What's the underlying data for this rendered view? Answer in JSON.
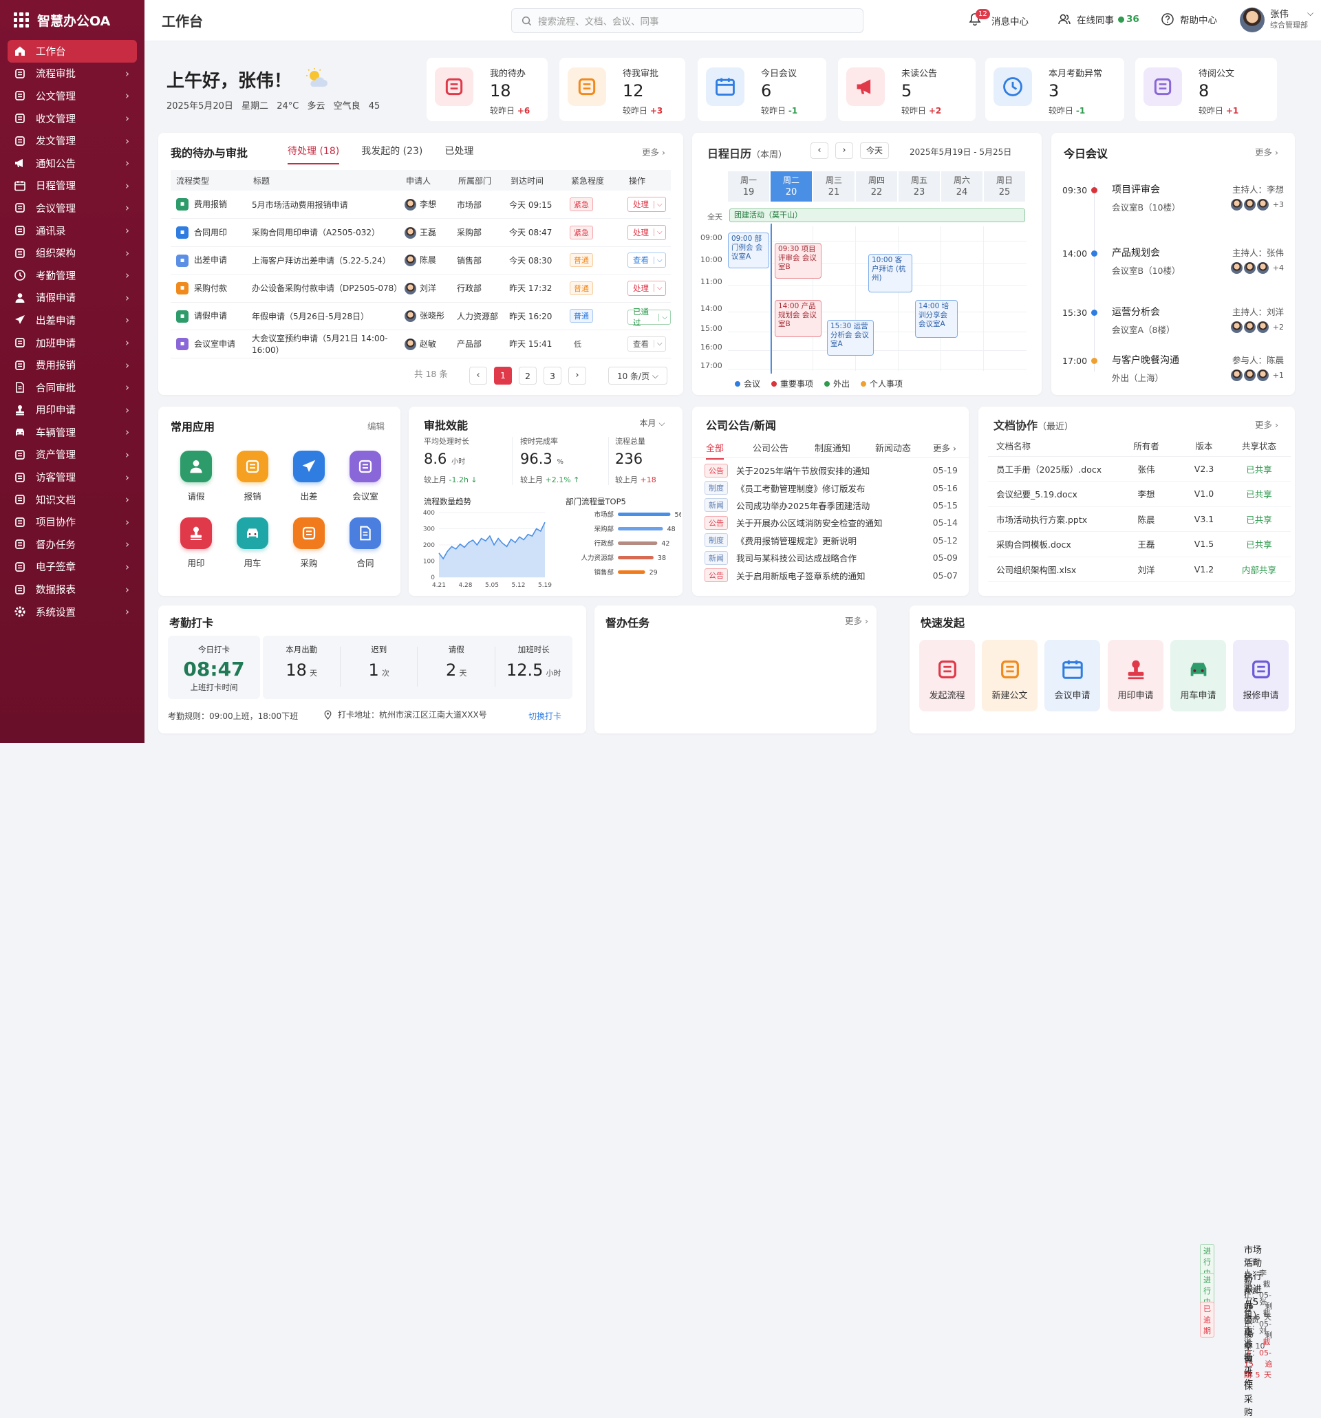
{
  "app": {
    "name": "智慧办公OA"
  },
  "sidebar": {
    "items": [
      {
        "label": "工作台",
        "icon": "home-icon",
        "active": true
      },
      {
        "label": "流程审批",
        "icon": "layers-icon"
      },
      {
        "label": "公文管理",
        "icon": "folder-icon"
      },
      {
        "label": "收文管理",
        "icon": "mail-icon"
      },
      {
        "label": "发文管理",
        "icon": "send-icon"
      },
      {
        "label": "通知公告",
        "icon": "megaphone-icon"
      },
      {
        "label": "日程管理",
        "icon": "calendar-icon"
      },
      {
        "label": "会议管理",
        "icon": "meeting-icon"
      },
      {
        "label": "通讯录",
        "icon": "contacts-icon"
      },
      {
        "label": "组织架构",
        "icon": "org-icon"
      },
      {
        "label": "考勤管理",
        "icon": "clock-icon"
      },
      {
        "label": "请假申请",
        "icon": "user-leave-icon"
      },
      {
        "label": "出差申请",
        "icon": "plane-icon"
      },
      {
        "label": "加班申请",
        "icon": "overtime-icon"
      },
      {
        "label": "费用报销",
        "icon": "wallet-icon"
      },
      {
        "label": "合同审批",
        "icon": "contract-icon"
      },
      {
        "label": "用印申请",
        "icon": "stamp-icon"
      },
      {
        "label": "车辆管理",
        "icon": "car-icon"
      },
      {
        "label": "资产管理",
        "icon": "box-icon"
      },
      {
        "label": "访客管理",
        "icon": "visitor-icon"
      },
      {
        "label": "知识文档",
        "icon": "book-icon"
      },
      {
        "label": "项目协作",
        "icon": "project-icon"
      },
      {
        "label": "督办任务",
        "icon": "task-icon"
      },
      {
        "label": "电子签章",
        "icon": "sign-icon"
      },
      {
        "label": "数据报表",
        "icon": "chart-icon"
      },
      {
        "label": "系统设置",
        "icon": "gear-icon"
      }
    ]
  },
  "header": {
    "title": "工作台",
    "search_placeholder": "搜索流程、文档、会议、同事",
    "notify_count": "12",
    "notify_label": "消息中心",
    "online_label": "在线同事",
    "online_count": "36",
    "help_label": "帮助中心",
    "user_name": "张伟",
    "user_dept": "综合管理部"
  },
  "greeting": {
    "text": "上午好，张伟！",
    "date": "2025年5月20日",
    "weekday": "星期二",
    "weather": "24°C 多云",
    "air": "空气良 45"
  },
  "stats": [
    {
      "label": "我的待办",
      "value": "18",
      "cmp": "较昨日",
      "delta": "+6",
      "dir": "up",
      "icon": "clipboard-icon",
      "color": "#e0394a",
      "bg": "#fde8ea"
    },
    {
      "label": "待我审批",
      "value": "12",
      "cmp": "较昨日",
      "delta": "+3",
      "dir": "up",
      "icon": "approver-icon",
      "color": "#f08a1c",
      "bg": "#fff1e2"
    },
    {
      "label": "今日会议",
      "value": "6",
      "cmp": "较昨日",
      "delta": "-1",
      "dir": "down",
      "icon": "calendar-icon",
      "color": "#2f7de1",
      "bg": "#e6f0fc"
    },
    {
      "label": "未读公告",
      "value": "5",
      "cmp": "较昨日",
      "delta": "+2",
      "dir": "up",
      "icon": "megaphone-icon",
      "color": "#e0394a",
      "bg": "#fde8ea"
    },
    {
      "label": "本月考勤异常",
      "value": "3",
      "cmp": "较昨日",
      "delta": "-1",
      "dir": "down",
      "icon": "clock-icon",
      "color": "#2f7de1",
      "bg": "#e6f0fc"
    },
    {
      "label": "待阅公文",
      "value": "8",
      "cmp": "较昨日",
      "delta": "+1",
      "dir": "up",
      "icon": "document-icon",
      "color": "#8a67d8",
      "bg": "#efe9fb"
    }
  ],
  "todo": {
    "title": "我的待办与审批",
    "tabs": [
      "待处理 (18)",
      "我发起的 (23)",
      "已处理"
    ],
    "more": "更多",
    "columns": [
      "流程类型",
      "标题",
      "申请人",
      "所属部门",
      "到达时间",
      "紧急程度",
      "操作"
    ],
    "rows": [
      {
        "type": "费用报销",
        "title": "5月市场活动费用报销申请",
        "applicant": "李想",
        "dept": "市场部",
        "time": "今天 09:15",
        "urgency": "紧急",
        "uclass": "red",
        "action": "处理",
        "aclass": "red",
        "tcolor": "#2e9b6a"
      },
      {
        "type": "合同用印",
        "title": "采购合同用印申请（A2505-032）",
        "applicant": "王磊",
        "dept": "采购部",
        "time": "今天 08:47",
        "urgency": "紧急",
        "uclass": "red",
        "action": "处理",
        "aclass": "red",
        "tcolor": "#2f7de1"
      },
      {
        "type": "出差申请",
        "title": "上海客户拜访出差申请（5.22-5.24）",
        "applicant": "陈晨",
        "dept": "销售部",
        "time": "今天 08:30",
        "urgency": "普通",
        "uclass": "orange",
        "action": "查看",
        "aclass": "blue",
        "tcolor": "#5b8fe6"
      },
      {
        "type": "采购付款",
        "title": "办公设备采购付款申请（DP2505-078）",
        "applicant": "刘洋",
        "dept": "行政部",
        "time": "昨天 17:32",
        "urgency": "普通",
        "uclass": "orange",
        "action": "处理",
        "aclass": "red",
        "tcolor": "#f08a1c"
      },
      {
        "type": "请假申请",
        "title": "年假申请（5月26日-5月28日）",
        "applicant": "张晓彤",
        "dept": "人力资源部",
        "time": "昨天 16:20",
        "urgency": "普通",
        "uclass": "blue",
        "action": "已通过",
        "aclass": "green",
        "tcolor": "#2e9b6a"
      },
      {
        "type": "会议室申请",
        "title": "大会议室预约申请（5月21日 14:00-16:00）",
        "applicant": "赵敏",
        "dept": "产品部",
        "time": "昨天 15:41",
        "urgency": "低",
        "uclass": "plain",
        "action": "查看",
        "aclass": "gray",
        "tcolor": "#8a67d8"
      }
    ],
    "total": "共 18 条",
    "pages": [
      "1",
      "2",
      "3"
    ],
    "page_size": "10 条/页"
  },
  "calendar": {
    "title": "日程日历",
    "sub": "（本周）",
    "today_btn": "今天",
    "range": "2025年5月19日 - 5月25日",
    "days": [
      {
        "w": "周一",
        "d": "19"
      },
      {
        "w": "周二",
        "d": "20"
      },
      {
        "w": "周三",
        "d": "21"
      },
      {
        "w": "周四",
        "d": "22"
      },
      {
        "w": "周五",
        "d": "23"
      },
      {
        "w": "周六",
        "d": "24"
      },
      {
        "w": "周日",
        "d": "25"
      }
    ],
    "allday_label": "全天",
    "allday_event": "团建活动（莫干山）",
    "times": [
      "09:00",
      "10:00",
      "11:00",
      "14:00",
      "15:00",
      "16:00",
      "17:00"
    ],
    "events": [
      {
        "text": "09:00 部门例会 会议室A",
        "kind": "blue"
      },
      {
        "text": "09:30 项目评审会 会议室B",
        "kind": "red"
      },
      {
        "text": "10:00 客户拜访 (杭州)",
        "kind": "blue"
      },
      {
        "text": "14:00 产品规划会 会议室B",
        "kind": "red"
      },
      {
        "text": "15:30 运营分析会 会议室A",
        "kind": "blue"
      },
      {
        "text": "14:00 培训分享会 会议室A",
        "kind": "blue"
      }
    ],
    "legend": [
      {
        "label": "会议",
        "color": "#2f7de1"
      },
      {
        "label": "重要事项",
        "color": "#d9343c"
      },
      {
        "label": "外出",
        "color": "#2e9b4e"
      },
      {
        "label": "个人事项",
        "color": "#f0a030"
      }
    ]
  },
  "meetings": {
    "title": "今日会议",
    "more": "更多",
    "items": [
      {
        "time": "09:30",
        "name": "项目评审会",
        "room": "会议室B（10楼）",
        "host": "主持人：李想",
        "extra": "+3",
        "color": "#d9343c"
      },
      {
        "time": "14:00",
        "name": "产品规划会",
        "room": "会议室B（10楼）",
        "host": "主持人：张伟",
        "extra": "+4",
        "color": "#2f7de1"
      },
      {
        "time": "15:30",
        "name": "运营分析会",
        "room": "会议室A（8楼）",
        "host": "主持人：刘洋",
        "extra": "+2",
        "color": "#2f7de1"
      },
      {
        "time": "17:00",
        "name": "与客户晚餐沟通",
        "room": "外出（上海）",
        "host": "参与人：陈晨",
        "extra": "+1",
        "color": "#f0a030"
      }
    ]
  },
  "apps": {
    "title": "常用应用",
    "edit": "编辑",
    "items": [
      {
        "label": "请假",
        "icon": "user-leave-icon",
        "color": "#2e9b6a"
      },
      {
        "label": "报销",
        "icon": "yen-icon",
        "color": "#f5a020"
      },
      {
        "label": "出差",
        "icon": "plane-icon",
        "color": "#2f7de1"
      },
      {
        "label": "会议室",
        "icon": "meeting-room-icon",
        "color": "#8a67d8"
      },
      {
        "label": "用印",
        "icon": "stamp-icon",
        "color": "#e0394a"
      },
      {
        "label": "用车",
        "icon": "car-icon",
        "color": "#1fa7a8"
      },
      {
        "label": "采购",
        "icon": "cart-icon",
        "color": "#f07a1c"
      },
      {
        "label": "合同",
        "icon": "contract-icon",
        "color": "#4a7fe0"
      }
    ]
  },
  "efficiency": {
    "title": "审批效能",
    "period": "本月",
    "metrics": [
      {
        "label": "平均处理时长",
        "value": "8.6",
        "unit": "小时",
        "cmp": "较上月",
        "delta": "-1.2h",
        "dir": "down"
      },
      {
        "label": "按时完成率",
        "value": "96.3",
        "unit": "%",
        "cmp": "较上月",
        "delta": "+2.1%",
        "dir": "up2"
      },
      {
        "label": "流程总量",
        "value": "236",
        "unit": "",
        "cmp": "较上月",
        "delta": "+18",
        "dir": "up"
      }
    ],
    "trend_title": "流程数量趋势",
    "top_title": "部门流程量TOP5"
  },
  "chart_data": [
    {
      "type": "area",
      "title": "流程数量趋势",
      "x": [
        "4.21",
        "4.28",
        "5.05",
        "5.12",
        "5.19"
      ],
      "ylim": [
        0,
        400
      ],
      "yticks": [
        0,
        100,
        200,
        300,
        400
      ],
      "points": [
        150,
        115,
        160,
        190,
        175,
        205,
        185,
        215,
        230,
        200,
        240,
        225,
        255,
        200,
        240,
        210,
        190,
        235,
        215,
        250,
        232,
        265,
        255,
        300,
        285,
        340
      ],
      "color": "#4a8fe6"
    },
    {
      "type": "bar",
      "title": "部门流程量TOP5",
      "categories": [
        "市场部",
        "采购部",
        "行政部",
        "人力资源部",
        "销售部"
      ],
      "values": [
        56,
        48,
        42,
        38,
        29
      ],
      "colors": [
        "#4a8fe6",
        "#6ba1ea",
        "#b58b82",
        "#d86a52",
        "#f07a1c"
      ],
      "xlim": [
        0,
        60
      ]
    }
  ],
  "notice": {
    "title": "公司公告/新闻",
    "tabs": [
      "全部",
      "公司公告",
      "制度通知",
      "新闻动态"
    ],
    "more": "更多",
    "items": [
      {
        "tag": "公告",
        "kind": "red",
        "text": "关于2025年端午节放假安排的通知",
        "date": "05-19"
      },
      {
        "tag": "制度",
        "kind": "gray",
        "text": "《员工考勤管理制度》修订版发布",
        "date": "05-16"
      },
      {
        "tag": "新闻",
        "kind": "gray",
        "text": "公司成功举办2025年春季团建活动",
        "date": "05-15"
      },
      {
        "tag": "公告",
        "kind": "red",
        "text": "关于开展办公区域消防安全检查的通知",
        "date": "05-14"
      },
      {
        "tag": "制度",
        "kind": "gray",
        "text": "《费用报销管理规定》更新说明",
        "date": "05-12"
      },
      {
        "tag": "新闻",
        "kind": "gray",
        "text": "我司与某科技公司达成战略合作",
        "date": "05-09"
      },
      {
        "tag": "公告",
        "kind": "red",
        "text": "关于启用新版电子签章系统的通知",
        "date": "05-07"
      }
    ]
  },
  "docs": {
    "title": "文档协作",
    "sub": "（最近）",
    "more": "更多",
    "columns": [
      "文档名称",
      "所有者",
      "版本",
      "共享状态"
    ],
    "rows": [
      {
        "name": "员工手册（2025版）.docx",
        "owner": "张伟",
        "ver": "V2.3",
        "status": "已共享"
      },
      {
        "name": "会议纪要_5.19.docx",
        "owner": "李想",
        "ver": "V1.0",
        "status": "已共享"
      },
      {
        "name": "市场活动执行方案.pptx",
        "owner": "陈晨",
        "ver": "V3.1",
        "status": "已共享"
      },
      {
        "name": "采购合同模板.docx",
        "owner": "王磊",
        "ver": "V1.5",
        "status": "已共享"
      },
      {
        "name": "公司组织架构图.xlsx",
        "owner": "刘洋",
        "ver": "V1.2",
        "status": "内部共享"
      }
    ]
  },
  "attendance": {
    "title": "考勤打卡",
    "today_label": "今日打卡",
    "today_time": "08:47",
    "today_sub": "上班打卡时间",
    "items": [
      {
        "label": "本月出勤",
        "value": "18",
        "unit": "天"
      },
      {
        "label": "迟到",
        "value": "1",
        "unit": "次"
      },
      {
        "label": "请假",
        "value": "2",
        "unit": "天"
      },
      {
        "label": "加班时长",
        "value": "12.5",
        "unit": "小时"
      }
    ],
    "rule": "考勤规则：09:00上班，18:00下班",
    "address": "打卡地址：杭州市滨江区江南大道XXX号",
    "switch": "切换打卡"
  },
  "tasks": {
    "title": "督办任务",
    "more": "更多",
    "items": [
      {
        "status": "进行中",
        "kind": "green",
        "name": "市场活动执行跟进（5月）",
        "owner": "负责人：李想",
        "due": "截止：05-26",
        "left": "剩余 6 天",
        "late": false
      },
      {
        "status": "进行中",
        "kind": "green",
        "name": "新产品上市准备工作",
        "owner": "负责人：张伟",
        "due": "截止：05-30",
        "left": "剩余 10 天",
        "late": false
      },
      {
        "status": "已逾期",
        "kind": "red",
        "name": "办公楼空调维保采购",
        "owner": "负责人：刘洋",
        "due": "截止：05-15",
        "left": "逾期 5 天",
        "late": true
      }
    ]
  },
  "quick": {
    "title": "快速发起",
    "items": [
      {
        "label": "发起流程",
        "icon": "new-flow-icon",
        "color": "#e0394a",
        "bg": "#fdecee"
      },
      {
        "label": "新建公文",
        "icon": "new-doc-icon",
        "color": "#f08a1c",
        "bg": "#fff1e2"
      },
      {
        "label": "会议申请",
        "icon": "calendar-icon",
        "color": "#2f7de1",
        "bg": "#e8f1fc"
      },
      {
        "label": "用印申请",
        "icon": "stamp-icon",
        "color": "#e0394a",
        "bg": "#fdecee"
      },
      {
        "label": "用车申请",
        "icon": "car-icon",
        "color": "#2e9b6a",
        "bg": "#e6f5ee"
      },
      {
        "label": "报修申请",
        "icon": "wrench-icon",
        "color": "#6b5bd8",
        "bg": "#eeebfb"
      }
    ]
  }
}
